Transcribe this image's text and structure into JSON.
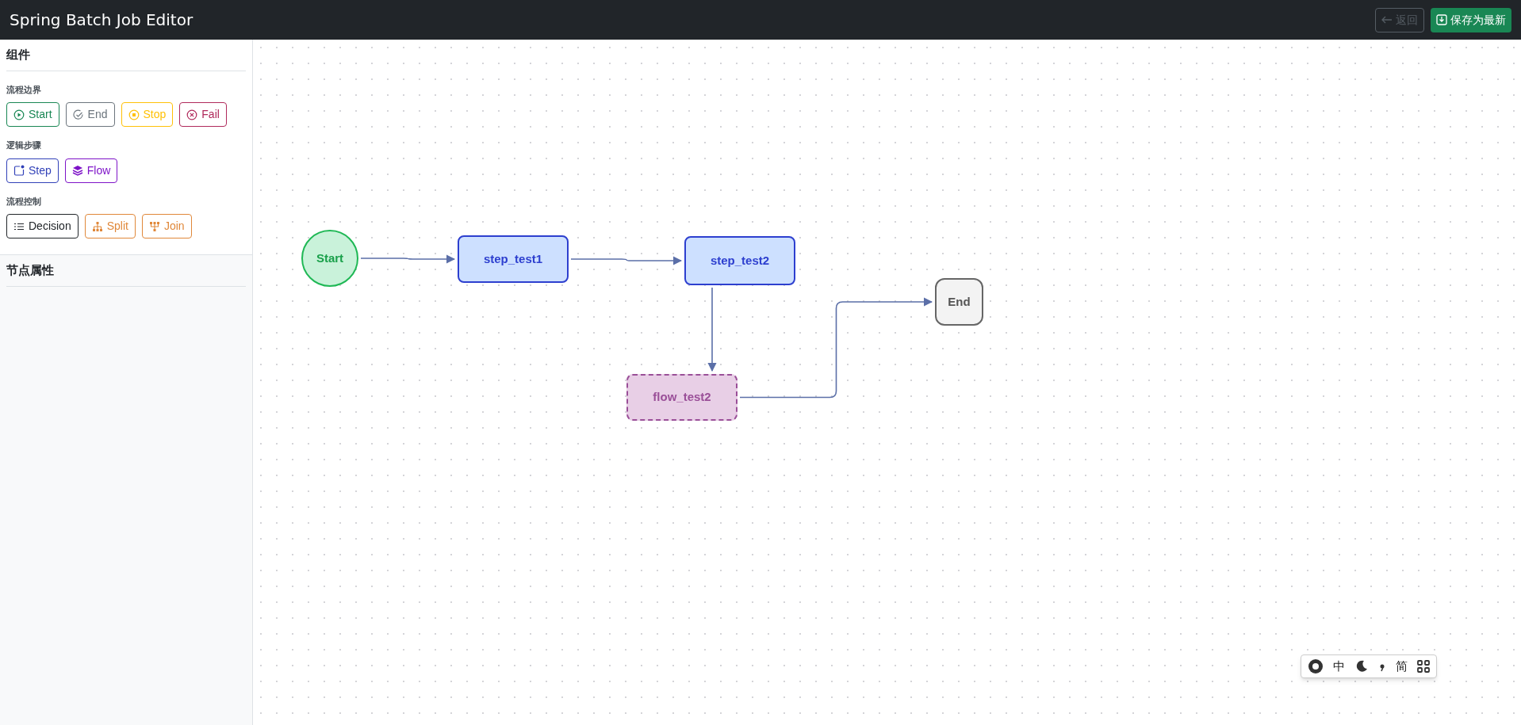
{
  "window": {
    "title": "Spring Batch Job Editor"
  },
  "header_buttons": [
    {
      "label": "返回",
      "kind": "back",
      "disabled": true
    },
    {
      "label": "保存为最新",
      "kind": "save",
      "disabled": false
    }
  ],
  "sidebar": {
    "title": "组件",
    "groups": [
      {
        "title": "流程边界",
        "items": [
          {
            "label": "Start",
            "kind": "start",
            "color": "#198754"
          },
          {
            "label": "End",
            "kind": "end",
            "color": "#6c757d"
          },
          {
            "label": "Stop",
            "kind": "stop",
            "color": "#ffc107"
          },
          {
            "label": "Fail",
            "kind": "fail",
            "color": "#b02a5b"
          }
        ]
      },
      {
        "title": "逻辑步骤",
        "items": [
          {
            "label": "Step",
            "kind": "step",
            "color": "#3141b8"
          },
          {
            "label": "Flow",
            "kind": "flow",
            "color": "#7e13c8"
          }
        ]
      },
      {
        "title": "流程控制",
        "items": [
          {
            "label": "Decision",
            "kind": "decision",
            "color": "#212529"
          },
          {
            "label": "Split",
            "kind": "split",
            "color": "#e0883a"
          },
          {
            "label": "Join",
            "kind": "join",
            "color": "#e0883a"
          }
        ]
      }
    ],
    "properties_title": "节点属性"
  },
  "canvas": {
    "nodes": [
      {
        "label": "Start",
        "kind": "start"
      },
      {
        "label": "step_test1",
        "kind": "step"
      },
      {
        "label": "step_test2",
        "kind": "step"
      },
      {
        "label": "End",
        "kind": "end"
      },
      {
        "label": "flow_test2",
        "kind": "flow"
      }
    ]
  },
  "ime_toolbar": {
    "mode": "中",
    "charset": "简"
  }
}
